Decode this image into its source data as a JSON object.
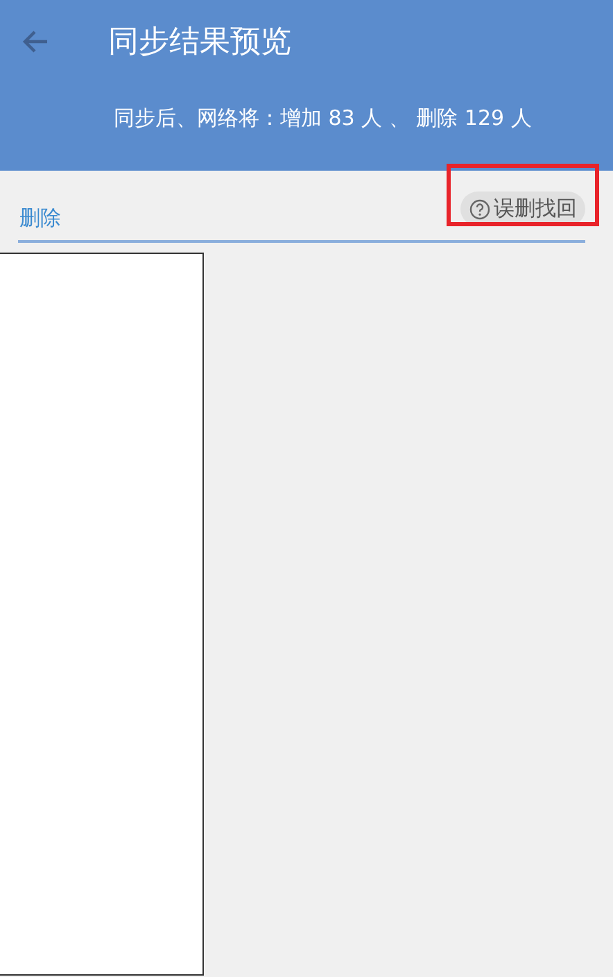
{
  "header": {
    "title": "同步结果预览",
    "summary": "同步后、网络将：增加 83 人 、 删除 129 人"
  },
  "tabs": [
    {
      "label": "删除",
      "selected": true
    }
  ],
  "recover_button": {
    "label": "误删找回",
    "highlighted": true
  },
  "list": {
    "kind": "empty"
  }
}
